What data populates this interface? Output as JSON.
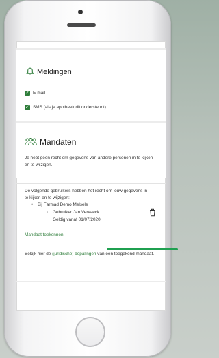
{
  "meldingen": {
    "title": "Meldingen",
    "options": [
      {
        "label": "E-mail",
        "checked": true
      },
      {
        "label": "SMS (als je apotheek dit ondersteunt)",
        "checked": true
      }
    ]
  },
  "mandaten": {
    "title": "Mandaten",
    "no_rights_text": "Je hebt geen recht om gegevens van andere personen in te kijken en te wijzigen.",
    "rights_intro": "De volgende gebruikers hebben het recht om jouw gegevens in te kijken en te wijzigen:",
    "pharmacy": "Bij Farmad Demo Melsele",
    "user": "Gebruiker Jan Vervaeck",
    "valid_from": "Geldig vanaf 01/07/2020",
    "add_link": "Mandaat toekennen",
    "footer_prefix": "Bekijk hier de",
    "footer_link": "(juridische) bepalingen",
    "footer_suffix": "van een toegekend mandaat."
  },
  "colors": {
    "accent": "#2e7d3a",
    "highlight_line": "#1fa050"
  },
  "icons": {
    "bell": "bell-icon",
    "users": "users-icon",
    "delete": "trash-icon"
  }
}
